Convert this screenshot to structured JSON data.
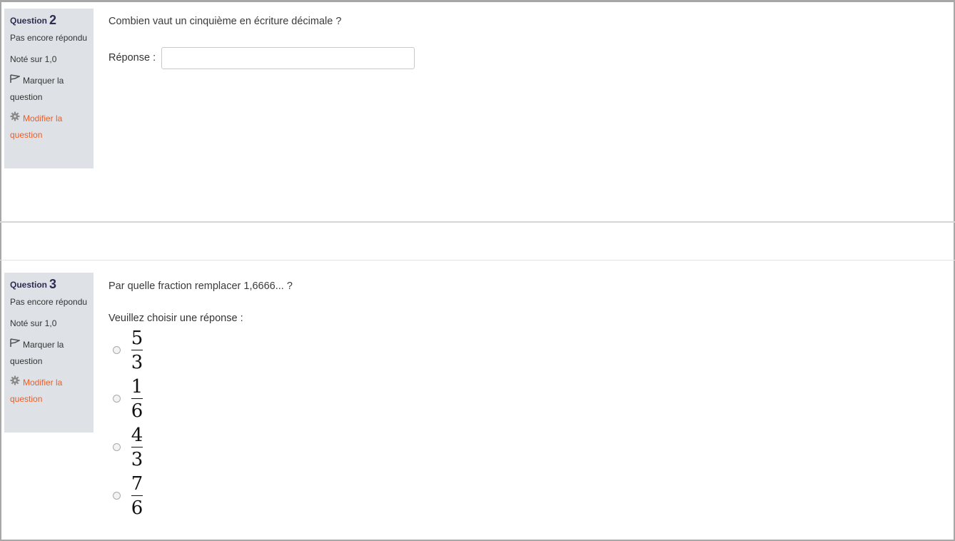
{
  "questions": [
    {
      "label": "Question",
      "number": "2",
      "state": "Pas encore répondu",
      "grade": "Noté sur 1,0",
      "flag_label": "Marquer la question",
      "edit_label": "Modifier la question",
      "text": "Combien vaut un cinquième en écriture décimale ?",
      "answer_label": "Réponse :",
      "answer_value": ""
    },
    {
      "label": "Question",
      "number": "3",
      "state": "Pas encore répondu",
      "grade": "Noté sur 1,0",
      "flag_label": "Marquer la question",
      "edit_label": "Modifier la question",
      "text": "Par quelle fraction remplacer 1,6666... ?",
      "prompt": "Veuillez choisir une réponse :",
      "choices": [
        {
          "numerator": "5",
          "denominator": "3"
        },
        {
          "numerator": "1",
          "denominator": "6"
        },
        {
          "numerator": "4",
          "denominator": "3"
        },
        {
          "numerator": "7",
          "denominator": "6"
        }
      ]
    }
  ],
  "colors": {
    "info_bg": "#dee2e6",
    "question_number": "#2b2c52",
    "edit_link": "#f15c24"
  },
  "icons": [
    "flag-icon",
    "gear-icon"
  ]
}
